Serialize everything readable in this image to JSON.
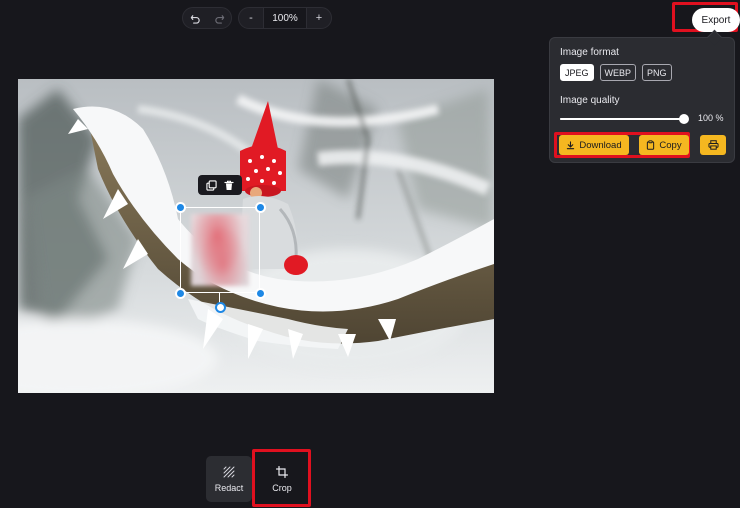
{
  "toolbar": {
    "undo_icon": "undo-icon",
    "redo_icon": "redo-icon",
    "zoom_out_label": "-",
    "zoom_level": "100%",
    "zoom_in_label": "+"
  },
  "export": {
    "button_label": "Export",
    "panel": {
      "format_label": "Image format",
      "formats": [
        "JPEG",
        "WEBP",
        "PNG"
      ],
      "selected_format": "JPEG",
      "quality_label": "Image quality",
      "quality_value": 100,
      "quality_display": "100 %",
      "download_label": "Download",
      "copy_label": "Copy",
      "print_icon": "printer-icon"
    }
  },
  "selection": {
    "duplicate_icon": "duplicate-icon",
    "delete_icon": "trash-icon"
  },
  "tools": {
    "redact_label": "Redact",
    "crop_label": "Crop"
  },
  "colors": {
    "accent": "#f5b720",
    "highlight": "#e0101f",
    "handle": "#1e88e5",
    "background": "#17171c"
  }
}
